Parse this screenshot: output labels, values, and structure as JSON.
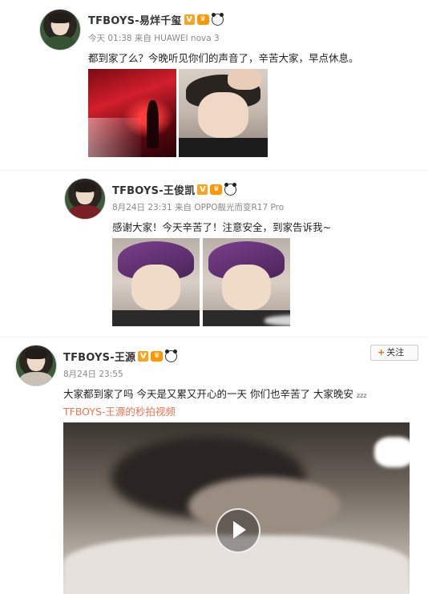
{
  "posts": [
    {
      "name": "TFBOYS-易烊千玺",
      "meta": "今天 01:38 来自 HUAWEI nova 3",
      "text": "都到家了么？今晚听见你们的声音了，辛苦大家，早点休息。"
    },
    {
      "name": "TFBOYS-王俊凯",
      "meta": "8月24日 23:31 来自 OPPO靓光而变R17 Pro",
      "text": "感谢大家！今天辛苦了！注意安全，到家告诉我~"
    },
    {
      "name": "TFBOYS-王源",
      "meta": "8月24日 23:55",
      "text": "大家都到家了吗  今天是又累又开心的一天  你们也辛苦了  大家晚安",
      "zzz": "zzz",
      "video_link": "TFBOYS-王源的秒拍视频",
      "follow_label": "关注",
      "follow_plus": "+"
    }
  ],
  "badges": {
    "verified": "V",
    "crown": "♛"
  },
  "colors": {
    "link": "#eb7350",
    "badge": "#f5a623",
    "crown": "#ff9800"
  },
  "icons": [
    "verified-icon",
    "crown-icon",
    "panda-icon",
    "play-icon"
  ]
}
